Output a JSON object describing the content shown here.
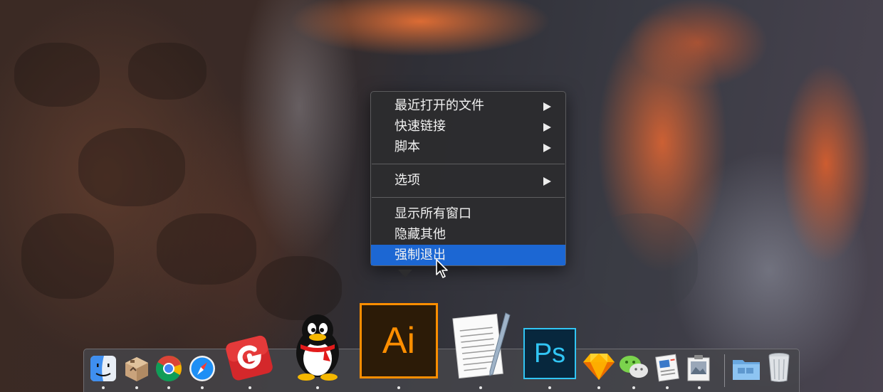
{
  "context_menu": {
    "items": [
      {
        "label": "最近打开的文件",
        "submenu": true
      },
      {
        "label": "快速链接",
        "submenu": true
      },
      {
        "label": "脚本",
        "submenu": true
      },
      {
        "label": "选项",
        "submenu": true
      },
      {
        "label": "显示所有窗口",
        "submenu": false
      },
      {
        "label": "隐藏其他",
        "submenu": false
      },
      {
        "label": "强制退出",
        "submenu": false,
        "selected": true
      }
    ],
    "highlight_color": "#1c67d3"
  },
  "dock": {
    "apps": [
      {
        "name": "finder-icon",
        "running": true
      },
      {
        "name": "archive-utility-icon",
        "running": true
      },
      {
        "name": "chrome-icon",
        "running": true
      },
      {
        "name": "safari-icon",
        "running": true
      },
      {
        "name": "foxmail-icon",
        "running": true
      },
      {
        "name": "qq-penguin-icon",
        "running": true
      },
      {
        "name": "illustrator-icon",
        "running": true,
        "label": "Ai"
      },
      {
        "name": "textedit-icon",
        "running": true
      },
      {
        "name": "photoshop-icon",
        "running": true,
        "label": "Ps"
      },
      {
        "name": "sketch-icon",
        "running": true
      },
      {
        "name": "wechat-icon",
        "running": true
      },
      {
        "name": "news-reader-icon",
        "running": true
      },
      {
        "name": "preview-icon",
        "running": true
      },
      {
        "name": "folder-icon",
        "running": false
      },
      {
        "name": "trash-icon",
        "running": false
      }
    ]
  }
}
